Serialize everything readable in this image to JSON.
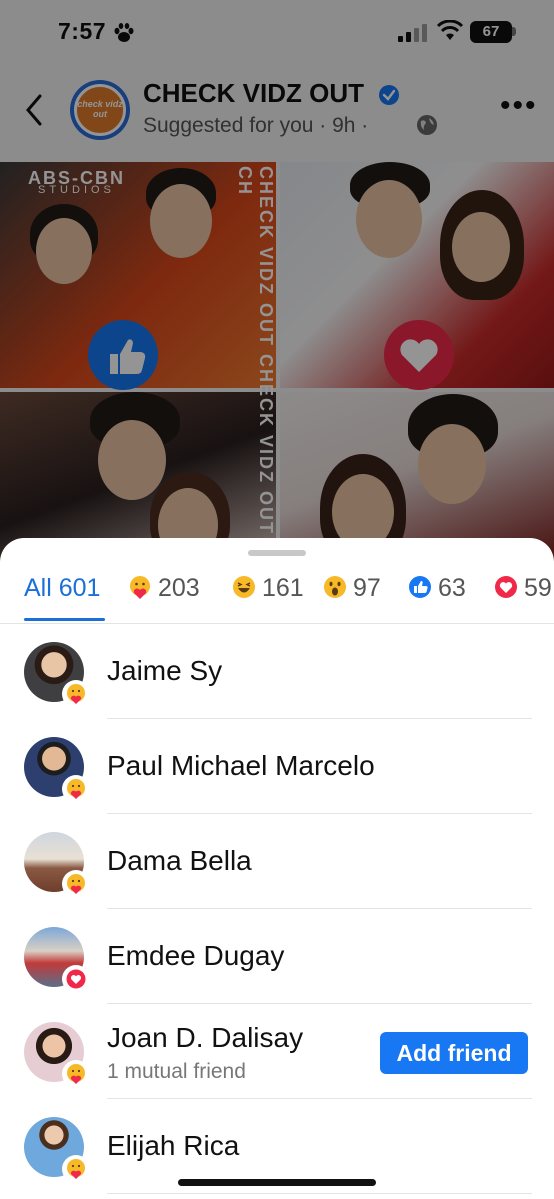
{
  "status_bar": {
    "time": "7:57",
    "battery": "67"
  },
  "post": {
    "page_name": "CHECK VIDZ OUT",
    "logo_text": "check vidz out",
    "meta": "Suggested for you · 9h ·",
    "photo_brand": "ABS-CBN",
    "photo_brand_sub": "STUDIOS",
    "watermark": "CHECK VIDZ OUT CHECK VIDZ OUT CH"
  },
  "tabs": [
    {
      "label": "All 601",
      "icon": "none"
    },
    {
      "label": "203",
      "icon": "care-emoji-icon"
    },
    {
      "label": "161",
      "icon": "haha-emoji-icon"
    },
    {
      "label": "97",
      "icon": "wow-emoji-icon"
    },
    {
      "label": "63",
      "icon": "like-icon"
    },
    {
      "label": "59",
      "icon": "love-icon"
    }
  ],
  "people": [
    {
      "name": "Jaime Sy",
      "reaction": "care"
    },
    {
      "name": "Paul Michael Marcelo",
      "reaction": "care"
    },
    {
      "name": "Dama Bella",
      "reaction": "care"
    },
    {
      "name": "Emdee Dugay",
      "reaction": "love"
    },
    {
      "name": "Joan D. Dalisay",
      "subtitle": "1 mutual friend",
      "reaction": "care",
      "action": "Add friend"
    },
    {
      "name": "Elijah Rica",
      "reaction": "care"
    }
  ],
  "colors": {
    "accent": "#1877f2",
    "love": "#f02849",
    "care": "#f7b928"
  }
}
